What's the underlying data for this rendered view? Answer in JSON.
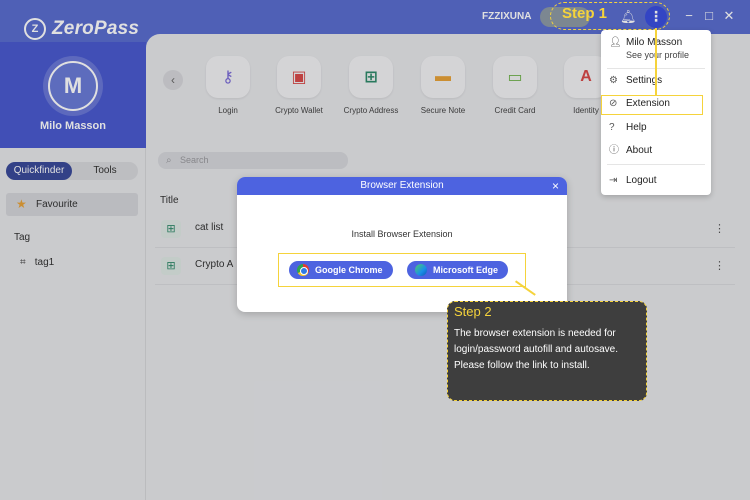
{
  "app": {
    "logo_text": "ZeroPass",
    "logo_mark": "Z"
  },
  "profile": {
    "initial": "M",
    "name": "Milo Masson"
  },
  "titlebar": {
    "account_label": "FZZIXUNA",
    "bell_icon": "bell-icon",
    "menu_icon": "⋮",
    "minimize": "−",
    "maximize": "□",
    "close": "✕"
  },
  "sidebar": {
    "tabs": [
      {
        "label": "Quickfinder",
        "active": true
      },
      {
        "label": "Tools",
        "active": false
      }
    ],
    "favourite_label": "Favourite",
    "tag_heading": "Tag",
    "tags": [
      "tag1"
    ]
  },
  "categories": [
    {
      "label": "Login",
      "glyph": "⚷",
      "color": "#7a6ad8"
    },
    {
      "label": "Crypto Wallet",
      "glyph": "▣",
      "color": "#d94a4a"
    },
    {
      "label": "Crypto Address",
      "glyph": "⊞",
      "color": "#2f8a6a"
    },
    {
      "label": "Secure Note",
      "glyph": "▬",
      "color": "#e8a23a"
    },
    {
      "label": "Credit Card",
      "glyph": "▭",
      "color": "#6fb24a"
    },
    {
      "label": "Identity",
      "glyph": "A",
      "color": "#d94a4a"
    }
  ],
  "search": {
    "placeholder": "Search"
  },
  "list": {
    "column_title": "Title",
    "rows": [
      {
        "label": "cat list"
      },
      {
        "label": "Crypto A"
      }
    ],
    "more_glyph": "⋮"
  },
  "modal": {
    "title": "Browser Extension",
    "subtitle": "Install Browser Extension",
    "close_glyph": "×",
    "buttons": [
      {
        "label": "Google Chrome",
        "icon": "chrome-icon"
      },
      {
        "label": "Microsoft Edge",
        "icon": "edge-icon"
      }
    ]
  },
  "menu": {
    "user_name": "Milo Masson",
    "user_sub": "See your profile",
    "items": [
      {
        "label": "Settings",
        "icon": "gear-icon"
      },
      {
        "label": "Extension",
        "icon": "compass-icon"
      },
      {
        "label": "Help",
        "icon": "help-icon"
      },
      {
        "label": "About",
        "icon": "info-icon"
      },
      {
        "label": "Logout",
        "icon": "logout-icon"
      }
    ]
  },
  "callouts": {
    "step1": "Step 1",
    "step2_title": "Step 2",
    "step2_text": "The browser extension is needed for login/password autofill and autosave. Please follow the link to install."
  },
  "colors": {
    "brand": "#5a6ed0",
    "accent": "#4d63e0",
    "highlight": "#f5d33b"
  }
}
